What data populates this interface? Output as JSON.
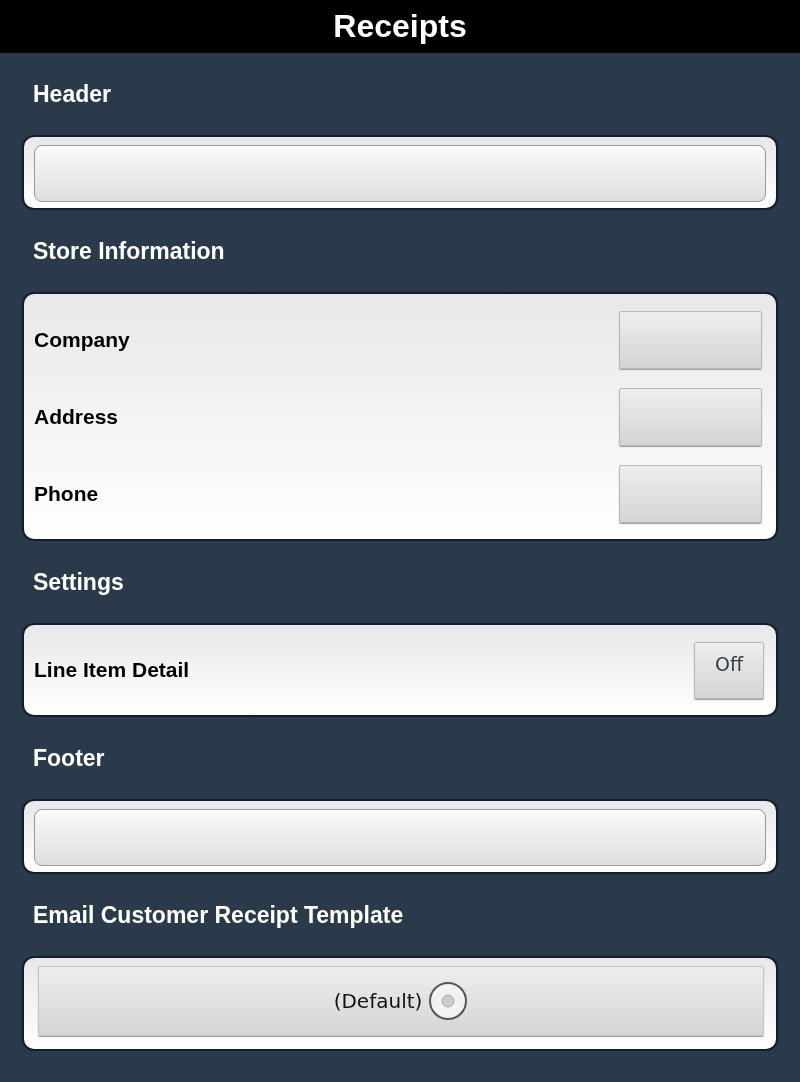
{
  "window": {
    "title": "Receipts"
  },
  "sections": [
    {
      "kind": "field",
      "heading": "Header"
    },
    {
      "kind": "rows",
      "heading": "Store Information",
      "rows": [
        {
          "label": "Company"
        },
        {
          "label": "Address"
        },
        {
          "label": "Phone"
        }
      ]
    },
    {
      "kind": "toggle",
      "heading": "Settings",
      "label": "Line Item Detail",
      "toggle": {
        "text": "Off",
        "on": false
      }
    },
    {
      "kind": "field",
      "heading": "Footer"
    },
    {
      "kind": "choice",
      "heading": "Email Customer Receipt Template",
      "choice": {
        "label": "(Default)",
        "selected": false
      }
    }
  ]
}
